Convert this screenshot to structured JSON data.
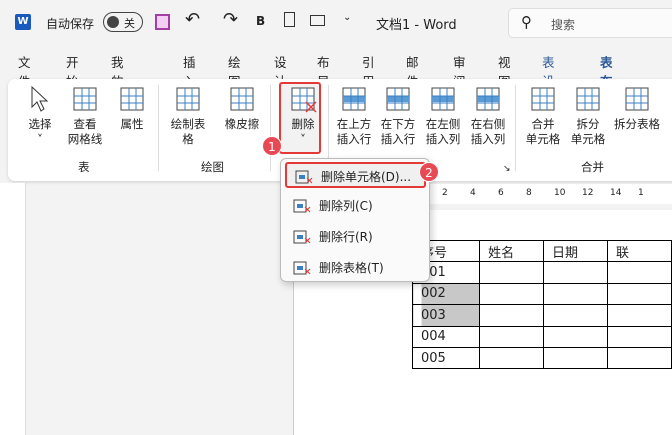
{
  "titlebar": {
    "autosave_label": "自动保存",
    "autosave_state": "关",
    "bold": "B",
    "doc_title": "文档1  -  Word",
    "search_placeholder": "搜索"
  },
  "tabs": [
    "文件",
    "开始",
    "我的模板",
    "插入",
    "绘图",
    "设计",
    "布局",
    "引用",
    "邮件",
    "审阅",
    "视图",
    "表设计",
    "表布局"
  ],
  "active_tab": "表布局",
  "accent": "#2b579a",
  "ribbon": {
    "buttons": [
      {
        "l1": "选择",
        "l2": "˅"
      },
      {
        "l1": "查看",
        "l2": "网格线"
      },
      {
        "l1": "属性",
        "l2": ""
      },
      {
        "l1": "绘制表格",
        "l2": ""
      },
      {
        "l1": "橡皮擦",
        "l2": ""
      },
      {
        "l1": "删除",
        "l2": "˅"
      },
      {
        "l1": "在上方",
        "l2": "插入行"
      },
      {
        "l1": "在下方",
        "l2": "插入行"
      },
      {
        "l1": "在左侧",
        "l2": "插入列"
      },
      {
        "l1": "在右侧",
        "l2": "插入列"
      },
      {
        "l1": "合并",
        "l2": "单元格"
      },
      {
        "l1": "拆分",
        "l2": "单元格"
      },
      {
        "l1": "拆分表格",
        "l2": ""
      }
    ],
    "groups": [
      "表",
      "绘图",
      "合并"
    ]
  },
  "badges": [
    "1",
    "2"
  ],
  "menu": [
    "删除单元格(D)...",
    "删除列(C)",
    "删除行(R)",
    "删除表格(T)"
  ],
  "ruler": [
    "2",
    "4",
    "6",
    "8",
    "10",
    "12",
    "14",
    "1"
  ],
  "table": {
    "rows": [
      [
        "序号",
        "姓名",
        "日期",
        "联"
      ],
      [
        "001",
        "",
        "",
        ""
      ],
      [
        "002",
        "",
        "",
        ""
      ],
      [
        "003",
        "",
        "",
        ""
      ],
      [
        "004",
        "",
        "",
        ""
      ],
      [
        "005",
        "",
        "",
        ""
      ]
    ],
    "selected_rows": [
      2,
      3
    ]
  }
}
